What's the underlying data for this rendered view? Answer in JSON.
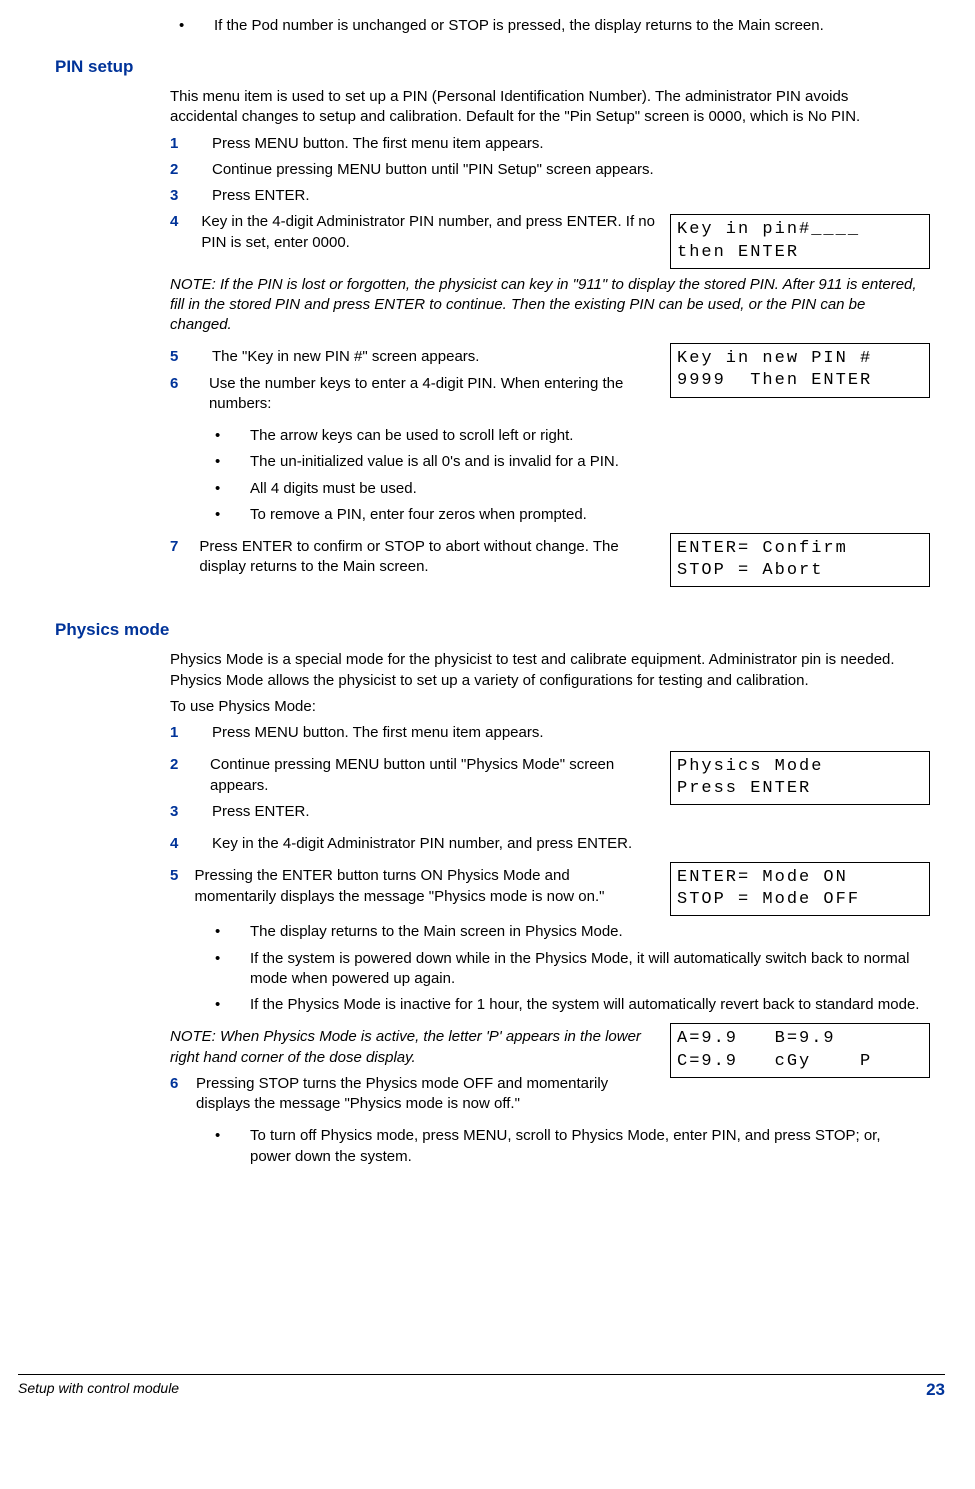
{
  "top_bullet": "If the Pod number is unchanged or STOP is pressed, the display returns to the Main screen.",
  "pin_setup": {
    "title": "PIN setup",
    "intro": "This menu item is used to set up a PIN (Personal Identification Number). The administrator PIN avoids accidental changes to setup and calibration. Default for the \"Pin Setup\" screen is 0000, which is No PIN.",
    "steps": {
      "s1": "Press MENU button. The first menu item appears.",
      "s2": "Continue pressing MENU button until \"PIN Setup\" screen appears.",
      "s3": "Press ENTER.",
      "s4": "Key in the 4-digit Administrator PIN number, and press ENTER. If no PIN is set, enter 0000.",
      "note1": "NOTE: If the PIN is lost or forgotten, the physicist can key in \"911\" to display the stored PIN. After 911 is entered, fill in the stored PIN and press ENTER to continue. Then the existing PIN can be used, or the PIN can be changed.",
      "s5": "The \"Key in new PIN #\" screen appears.",
      "s6": "Use the number keys to enter a 4-digit PIN. When entering the numbers:",
      "s6_bullets": {
        "b1": "The arrow keys can be used to scroll left or right.",
        "b2": "The un-initialized value is all 0's and is invalid for a PIN.",
        "b3": "All 4 digits must be used.",
        "b4": "To remove a PIN, enter four zeros when prompted."
      },
      "s7": "Press ENTER to confirm or STOP to abort without change. The display returns to the Main screen."
    },
    "displays": {
      "d1": "Key in pin#____\nthen ENTER",
      "d2": "Key in new PIN #\n9999  Then ENTER",
      "d3": "ENTER= Confirm\nSTOP = Abort"
    }
  },
  "physics_mode": {
    "title": "Physics mode",
    "intro": "Physics Mode is a special mode for the physicist to test and calibrate equipment. Administrator pin is needed. Physics Mode allows the physicist to set up a variety of configurations for testing and calibration.",
    "intro2": "To use Physics Mode:",
    "steps": {
      "s1": "Press MENU button. The first menu item appears.",
      "s2": "Continue pressing MENU button until \"Physics Mode\" screen appears.",
      "s3": "Press ENTER.",
      "s4": "Key in the 4-digit Administrator PIN number, and press ENTER.",
      "s5": "Pressing the ENTER button turns ON Physics Mode and momentarily displays the message \"Physics mode is now on.\"",
      "s5_bullets": {
        "b1": "The display returns to the Main screen in Physics Mode.",
        "b2": "If the system is powered down while in the Physics Mode, it will automatically switch back to normal mode when powered up again.",
        "b3": "If the Physics Mode is inactive for 1 hour, the system will automatically revert back to standard mode."
      },
      "note1": "NOTE: When Physics Mode is active, the letter 'P' appears in the lower right hand corner of the dose display.",
      "s6": "Pressing STOP turns the Physics mode OFF and momentarily displays the message \"Physics mode is now off.\"",
      "s6_bullets": {
        "b1": "To turn off Physics mode, press MENU, scroll to Physics Mode, enter PIN, and press STOP; or, power down the system."
      }
    },
    "displays": {
      "d1": "Physics Mode\nPress ENTER",
      "d2": "ENTER= Mode ON\nSTOP = Mode OFF",
      "d3": "A=9.9   B=9.9\nC=9.9   cGy    P"
    }
  },
  "footer": {
    "left": "Setup with control module",
    "page": "23"
  }
}
